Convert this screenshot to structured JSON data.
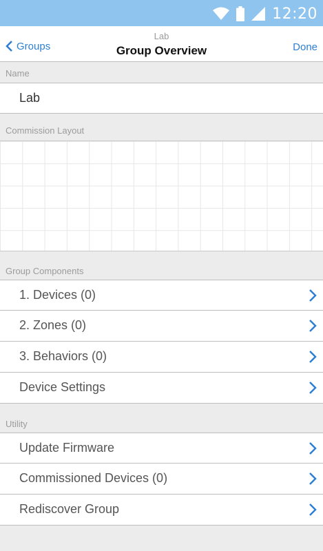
{
  "status_bar": {
    "time": "12:20",
    "wifi_icon": "wifi-icon",
    "battery_icon": "battery-icon",
    "signal_icon": "signal-icon"
  },
  "nav": {
    "back_label": "Groups",
    "subtitle": "Lab",
    "title": "Group Overview",
    "done_label": "Done"
  },
  "name_section": {
    "header": "Name",
    "value": "Lab"
  },
  "layout_section": {
    "header": "Commission Layout"
  },
  "components_section": {
    "header": "Group Components",
    "items": [
      {
        "label": "1. Devices (0)"
      },
      {
        "label": "2. Zones (0)"
      },
      {
        "label": "3. Behaviors (0)"
      },
      {
        "label": "Device Settings"
      }
    ]
  },
  "utility_section": {
    "header": "Utility",
    "items": [
      {
        "label": "Update Firmware"
      },
      {
        "label": "Commissioned Devices (0)"
      },
      {
        "label": "Rediscover Group"
      }
    ]
  },
  "colors": {
    "accent": "#2d7fd2",
    "status_bar": "#8fc4ee",
    "background": "#ececec"
  }
}
